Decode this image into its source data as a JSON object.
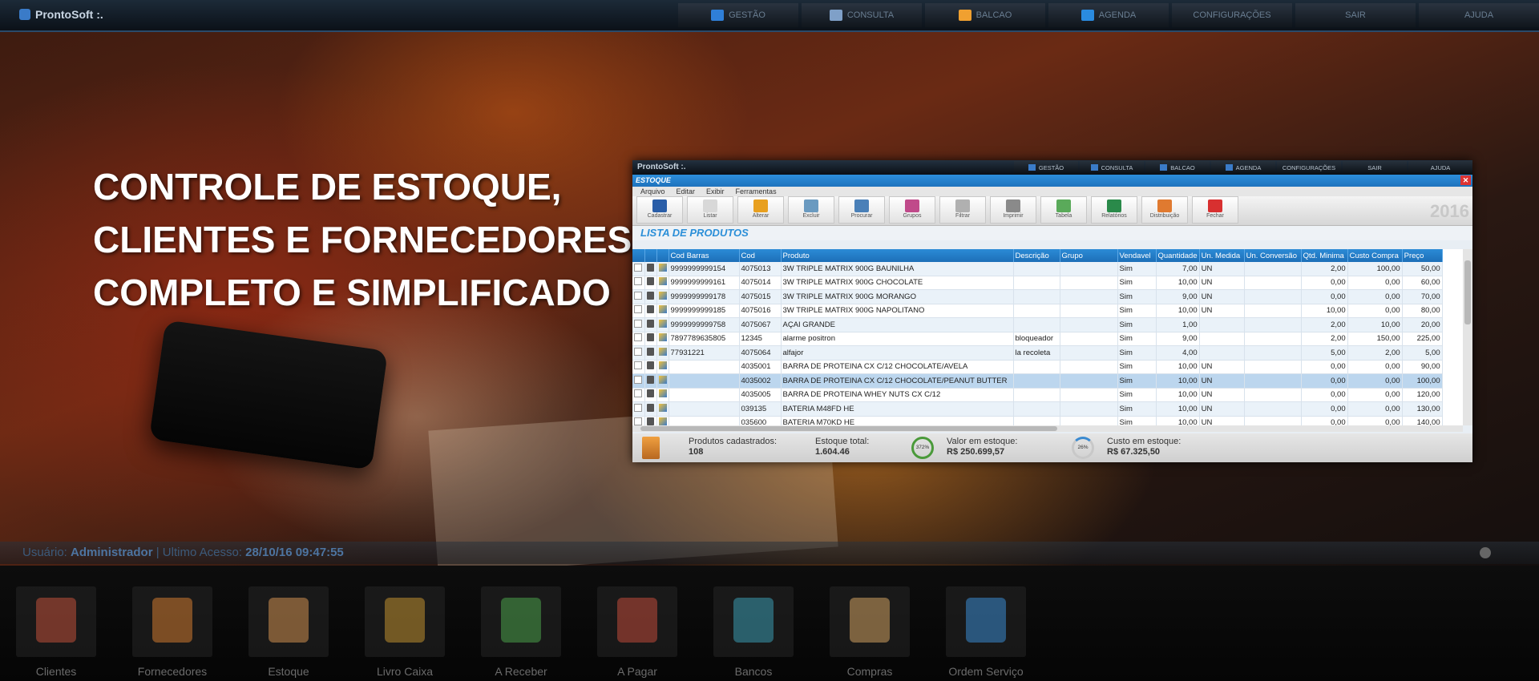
{
  "topbar": {
    "brand": "ProntoSoft :.",
    "nav": [
      {
        "label": "GESTÃO",
        "icon": "chart-icon",
        "color": "#2f7fd8"
      },
      {
        "label": "CONSULTA",
        "icon": "search-icon",
        "color": "#7fa0c8"
      },
      {
        "label": "BALCAO",
        "icon": "store-icon",
        "color": "#f0a030"
      },
      {
        "label": "AGENDA",
        "icon": "calendar-icon",
        "color": "#2a8be0"
      },
      {
        "label": "CONFIGURAÇÕES",
        "icon": "",
        "color": ""
      },
      {
        "label": "SAIR",
        "icon": "",
        "color": ""
      },
      {
        "label": "AJUDA",
        "icon": "",
        "color": ""
      }
    ]
  },
  "headline": {
    "line1": "CONTROLE DE ESTOQUE,",
    "line2": "CLIENTES E FORNECEDORES,",
    "line3": "COMPLETO E SIMPLIFICADO"
  },
  "window": {
    "brand": "ProntoSoft :.",
    "nav": [
      "GESTÃO",
      "CONSULTA",
      "BALCAO",
      "AGENDA",
      "CONFIGURAÇÕES",
      "SAIR",
      "AJUDA"
    ],
    "title": "ESTOQUE",
    "close": "✕",
    "menu": [
      "Arquivo",
      "Editar",
      "Exibir",
      "Ferramentas"
    ],
    "toolbar": [
      {
        "label": "Cadastrar",
        "icon": "monitor-icon",
        "color": "#2a5ea8"
      },
      {
        "label": "Listar",
        "icon": "checklist-icon",
        "color": "#d8d8d8"
      },
      {
        "label": "Alterar",
        "icon": "edit-icon",
        "color": "#e8a020"
      },
      {
        "label": "Excluir",
        "icon": "trash-icon",
        "color": "#6a9ac0"
      },
      {
        "label": "Procurar",
        "icon": "magnifier-icon",
        "color": "#4a80b8"
      },
      {
        "label": "Grupos",
        "icon": "group-icon",
        "color": "#c04a8a"
      },
      {
        "label": "Filtrar",
        "icon": "filter-icon",
        "color": "#b0b0b0"
      },
      {
        "label": "Imprimir",
        "icon": "printer-icon",
        "color": "#8a8a8a"
      },
      {
        "label": "Tabela",
        "icon": "table-icon",
        "color": "#5aaa5a"
      },
      {
        "label": "Relatórios",
        "icon": "report-icon",
        "color": "#2a8a4a"
      },
      {
        "label": "Distribuição",
        "icon": "distribution-icon",
        "color": "#e07a30"
      },
      {
        "label": "Fechar",
        "icon": "close-icon",
        "color": "#d83030"
      }
    ],
    "year": "2016",
    "list_title": "LISTA DE PRODUTOS",
    "columns": [
      "Cod Barras",
      "Cod",
      "Produto",
      "Descrição",
      "Grupo",
      "Vendavel",
      "Quantidade",
      "Un. Medida",
      "Un. Conversão",
      "Qtd. Minima",
      "Custo Compra",
      "Preço"
    ],
    "rows": [
      [
        "9999999999154",
        "4075013",
        "3W TRIPLE MATRIX 900G BAUNILHA",
        "",
        "",
        "Sim",
        "7,00",
        "UN",
        "",
        "2,00",
        "100,00",
        "50,00"
      ],
      [
        "9999999999161",
        "4075014",
        "3W TRIPLE MATRIX 900G CHOCOLATE",
        "",
        "",
        "Sim",
        "10,00",
        "UN",
        "",
        "0,00",
        "0,00",
        "60,00"
      ],
      [
        "9999999999178",
        "4075015",
        "3W TRIPLE MATRIX 900G MORANGO",
        "",
        "",
        "Sim",
        "9,00",
        "UN",
        "",
        "0,00",
        "0,00",
        "70,00"
      ],
      [
        "9999999999185",
        "4075016",
        "3W TRIPLE MATRIX 900G NAPOLITANO",
        "",
        "",
        "Sim",
        "10,00",
        "UN",
        "",
        "10,00",
        "0,00",
        "80,00"
      ],
      [
        "9999999999758",
        "4075067",
        "AÇAI GRANDE",
        "",
        "",
        "Sim",
        "1,00",
        "",
        "",
        "2,00",
        "10,00",
        "20,00"
      ],
      [
        "7897789635805",
        "12345",
        "alarme positron",
        "bloqueador",
        "",
        "Sim",
        "9,00",
        "",
        "",
        "2,00",
        "150,00",
        "225,00"
      ],
      [
        "77931221",
        "4075064",
        "alfajor",
        "la recoleta",
        "",
        "Sim",
        "4,00",
        "",
        "",
        "5,00",
        "2,00",
        "5,00"
      ],
      [
        "",
        "4035001",
        "BARRA DE PROTEINA CX C/12 CHOCOLATE/AVELA",
        "",
        "",
        "Sim",
        "10,00",
        "UN",
        "",
        "0,00",
        "0,00",
        "90,00"
      ],
      [
        "",
        "4035002",
        "BARRA DE PROTEINA CX C/12 CHOCOLATE/PEANUT BUTTER",
        "",
        "",
        "Sim",
        "10,00",
        "UN",
        "",
        "0,00",
        "0,00",
        "100,00"
      ],
      [
        "",
        "4035005",
        "BARRA DE PROTEINA WHEY NUTS CX C/12",
        "",
        "",
        "Sim",
        "10,00",
        "UN",
        "",
        "0,00",
        "0,00",
        "120,00"
      ],
      [
        "",
        "039135",
        "BATERIA M48FD HE",
        "",
        "",
        "Sim",
        "10,00",
        "UN",
        "",
        "0,00",
        "0,00",
        "130,00"
      ],
      [
        "",
        "035600",
        "BATERIA M70KD HE",
        "",
        "",
        "Sim",
        "10,00",
        "UN",
        "",
        "0,00",
        "0,00",
        "140,00"
      ]
    ],
    "selected_row": 8,
    "footer": {
      "produtos_label": "Produtos cadastrados:",
      "produtos_value": "108",
      "estoque_label": "Estoque total:",
      "estoque_value": "1.604.46",
      "ring1": "372%",
      "valor_label": "Valor em estoque:",
      "valor_value": "R$ 250.699,57",
      "ring2": "26%",
      "custo_label": "Custo em estoque:",
      "custo_value": "R$ 67.325,50"
    }
  },
  "status": {
    "user_label": "Usuário:",
    "user": "Administrador",
    "sep": " | Ultimo Acesso: ",
    "last_access": "28/10/16 09:47:55"
  },
  "dock": [
    {
      "label": "Clientes",
      "icon": "client-icon",
      "color": "#c0503a"
    },
    {
      "label": "Fornecedores",
      "icon": "supplier-icon",
      "color": "#d07a30"
    },
    {
      "label": "Estoque",
      "icon": "stock-icon",
      "color": "#d09050"
    },
    {
      "label": "Livro Caixa",
      "icon": "cashbook-icon",
      "color": "#c09030"
    },
    {
      "label": "A Receber",
      "icon": "receive-money-icon",
      "color": "#4aa04a"
    },
    {
      "label": "A Pagar",
      "icon": "pay-money-icon",
      "color": "#c04a3a"
    },
    {
      "label": "Bancos",
      "icon": "bank-safe-icon",
      "color": "#3a9ab0"
    },
    {
      "label": "Compras",
      "icon": "purchase-icon",
      "color": "#d0a060"
    },
    {
      "label": "Ordem Serviço",
      "icon": "service-order-icon",
      "color": "#3a8ad0"
    }
  ]
}
